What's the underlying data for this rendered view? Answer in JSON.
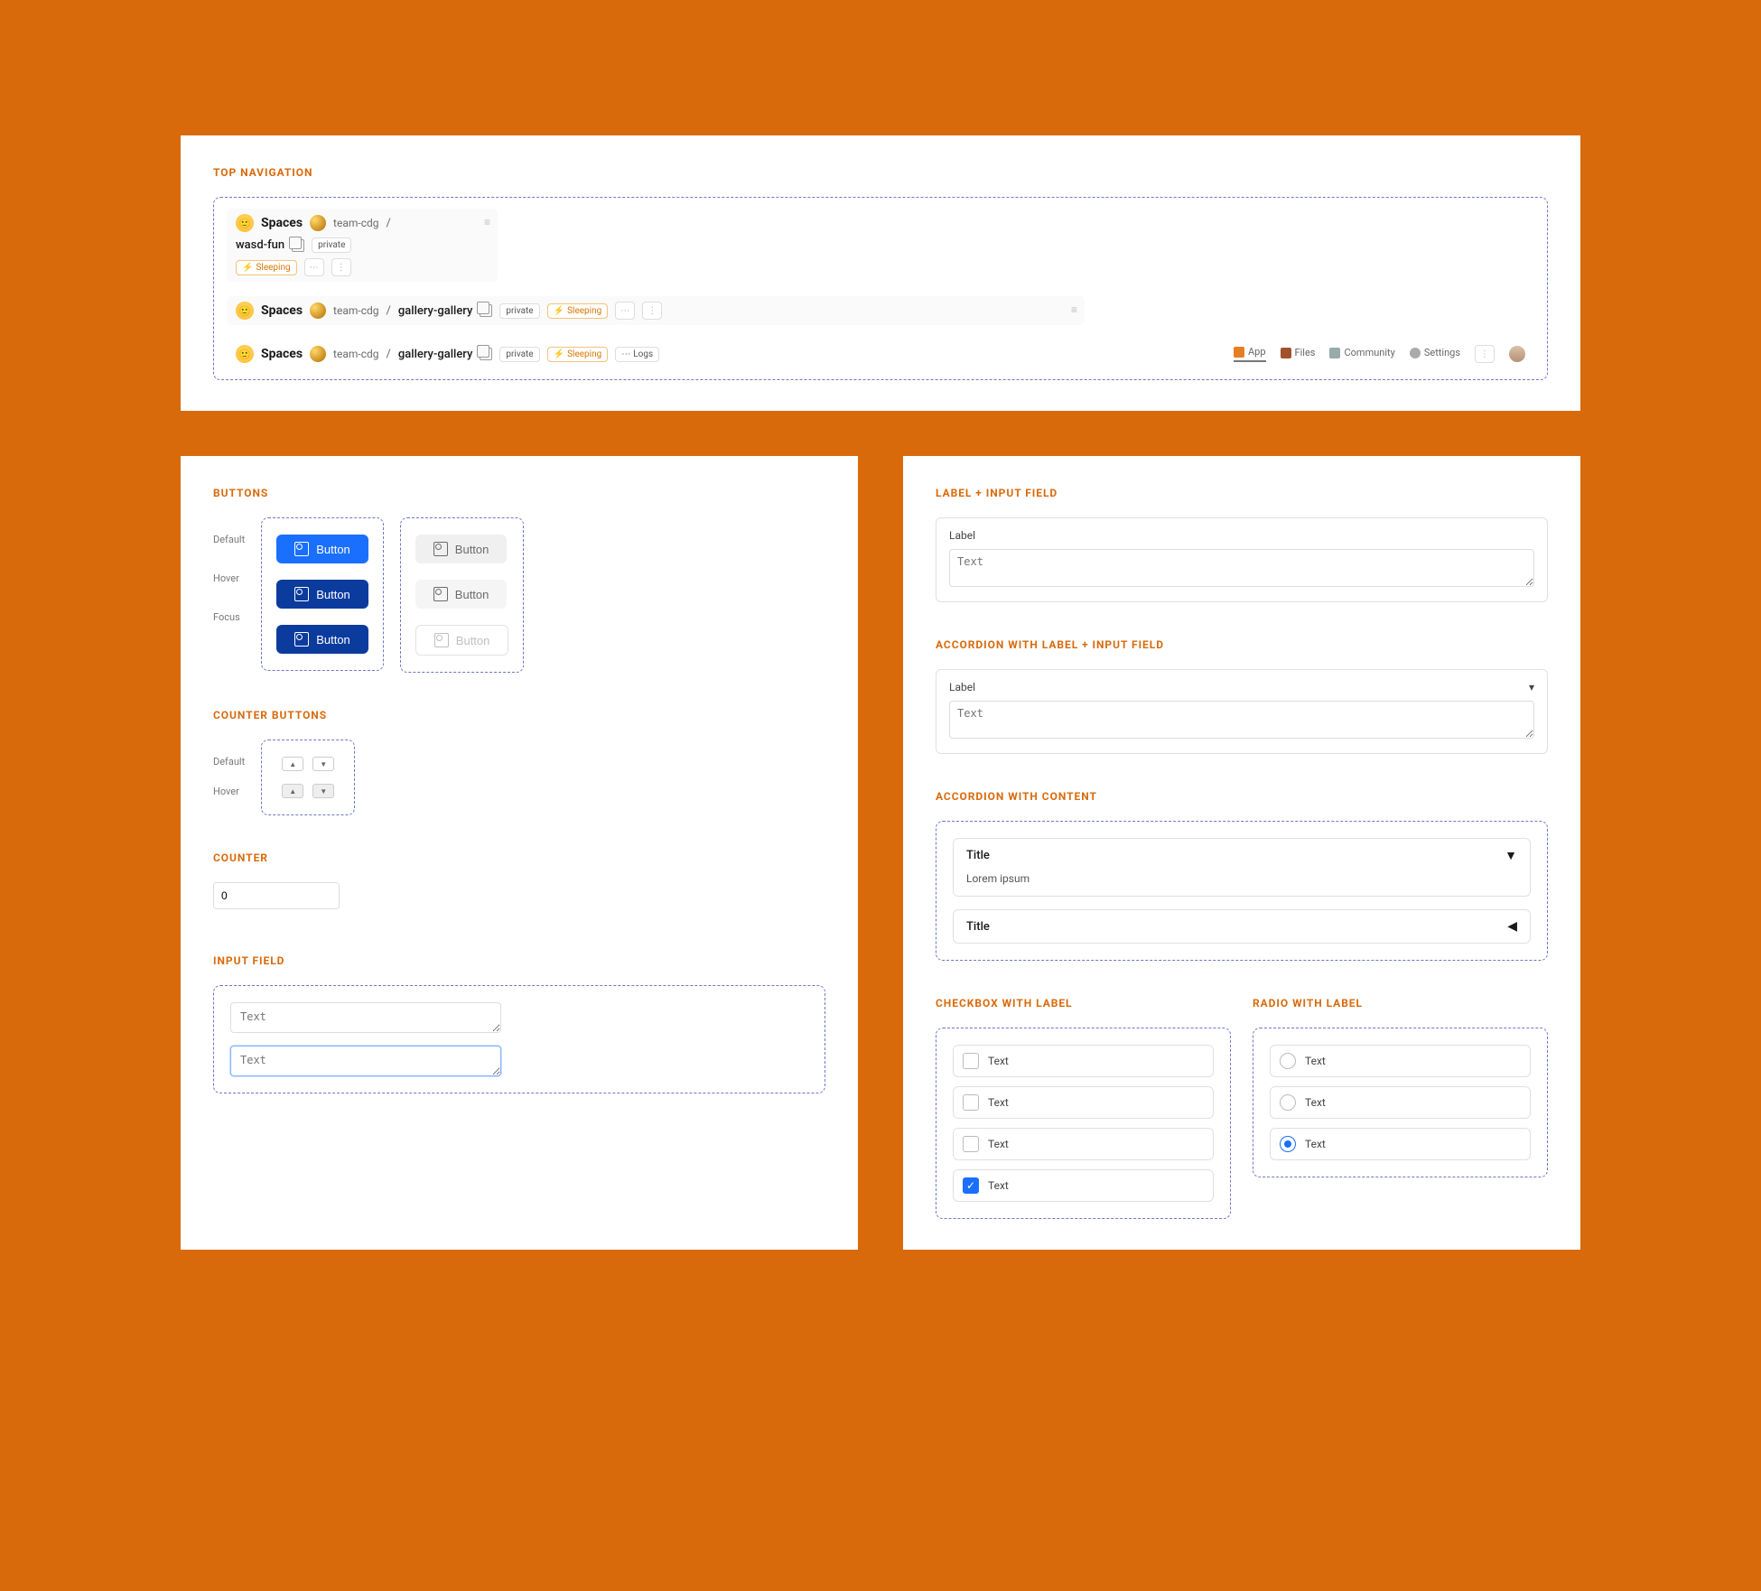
{
  "sections": {
    "top_nav": "TOP NAVIGATION",
    "buttons": "BUTTONS",
    "counter_buttons": "COUNTER BUTTONS",
    "counter": "COUNTER",
    "input_field": "INPUT FIELD",
    "label_input": "LABEL + INPUT FIELD",
    "accordion_label_input": "ACCORDION WITH LABEL + INPUT FIELD",
    "accordion_content": "ACCORDION WITH CONTENT",
    "checkbox_label": "CHECKBOX WITH LABEL",
    "radio_label": "RADIO WITH LABEL"
  },
  "nav": {
    "brand": "Spaces",
    "team": "team-cdg",
    "repo1": "wasd-fun",
    "repo2": "gallery-gallery",
    "tags": {
      "private": "private",
      "sleeping": "Sleeping",
      "logs": "Logs"
    },
    "tabs": {
      "app": "App",
      "files": "Files",
      "community": "Community",
      "settings": "Settings"
    },
    "ellipsis": "⋮"
  },
  "button_states": {
    "default": "Default",
    "hover": "Hover",
    "focus": "Focus"
  },
  "button": {
    "label": "Button"
  },
  "counter": {
    "value": "0"
  },
  "input": {
    "placeholder": "Text"
  },
  "label_field": {
    "label": "Label",
    "placeholder": "Text"
  },
  "accordion1": {
    "label": "Label",
    "placeholder": "Text"
  },
  "accordion_items": [
    {
      "title": "Title",
      "body": "Lorem ipsum",
      "open": true
    },
    {
      "title": "Title",
      "body": "",
      "open": false
    }
  ],
  "checkbox_items": [
    {
      "label": "Text",
      "checked": false
    },
    {
      "label": "Text",
      "checked": false
    },
    {
      "label": "Text",
      "checked": false
    },
    {
      "label": "Text",
      "checked": true
    }
  ],
  "radio_items": [
    {
      "label": "Text",
      "checked": false
    },
    {
      "label": "Text",
      "checked": false
    },
    {
      "label": "Text",
      "checked": true
    }
  ]
}
